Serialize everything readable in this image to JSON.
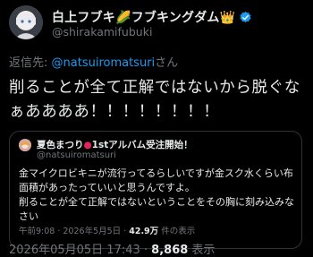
{
  "author": {
    "display_name": "白上フブキ🌽フブキングダム👑",
    "handle": "@shirakamifubuki"
  },
  "reply": {
    "prefix": "返信先: ",
    "mention": "@natsuiromatsuri",
    "suffix": "さん"
  },
  "tweet": {
    "text": "削ることが全て正解ではないから脱ぐなぁああああ！！！！！！！！"
  },
  "quote": {
    "display_name": "夏色まつり",
    "name_mark": "●",
    "name_suffix": "1stアルバム受注開始！",
    "handle": "@natsuiromatsuri",
    "text_line1": "金マイクロビキニが流行ってるらしいですが金スク水くらい布面積があったっていいと思うんですよ。",
    "text_line2": "削ることが全て正解ではないということをその胸に刻み込みなさい",
    "time": "午前9:08 · 2026年5月5日 · ",
    "views_value": "42.9万",
    "views_label": " 件の表示"
  },
  "meta": {
    "datetime": "2026年05月05日 17:43 · ",
    "views_value": "8,868",
    "views_label": " 表示"
  }
}
